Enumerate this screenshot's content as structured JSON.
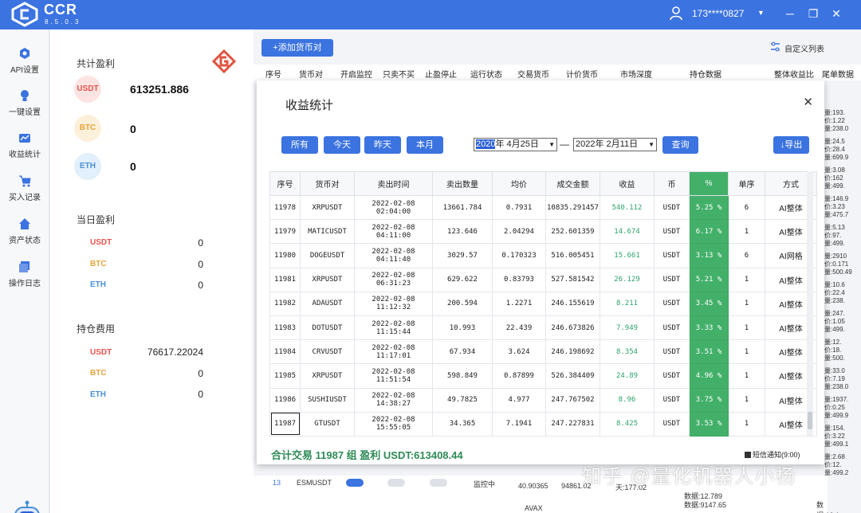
{
  "app": {
    "name": "CCR",
    "version": "8.5.0.3"
  },
  "user": {
    "phone": "173****0827"
  },
  "nav": [
    {
      "label": "API设置",
      "icon": "api-icon"
    },
    {
      "label": "一键设置",
      "icon": "bulb-icon"
    },
    {
      "label": "收益统计",
      "icon": "stats-icon"
    },
    {
      "label": "买入记录",
      "icon": "cart-icon"
    },
    {
      "label": "资产状态",
      "icon": "home-icon"
    },
    {
      "label": "操作日志",
      "icon": "log-icon"
    }
  ],
  "summary": {
    "total_title": "共计盈利",
    "total": [
      {
        "coin": "USDT",
        "value": "613251.886",
        "color": "#e8534c",
        "bg": "#fde4e3"
      },
      {
        "coin": "BTC",
        "value": "0",
        "color": "#e8a33a",
        "bg": "#fdf0da"
      },
      {
        "coin": "ETH",
        "value": "0",
        "color": "#4a8fd6",
        "bg": "#e2effc"
      }
    ],
    "daily_title": "当日盈利",
    "daily": [
      {
        "coin": "USDT",
        "value": "0",
        "color": "#e8534c"
      },
      {
        "coin": "BTC",
        "value": "0",
        "color": "#e8a33a"
      },
      {
        "coin": "ETH",
        "value": "0",
        "color": "#4a8fd6"
      }
    ],
    "fee_title": "持仓费用",
    "fee": [
      {
        "coin": "USDT",
        "value": "76617.22024",
        "color": "#e8534c"
      },
      {
        "coin": "BTC",
        "value": "0",
        "color": "#e8a33a"
      },
      {
        "coin": "ETH",
        "value": "0",
        "color": "#4a8fd6"
      }
    ]
  },
  "main": {
    "add_button": "+添加货币对",
    "custom_columns": "自定义列表",
    "headers": [
      "序号",
      "货币对",
      "开启监控",
      "只卖不买",
      "止盈停止",
      "运行状态",
      "交易货币",
      "计价货币",
      "市场深度",
      "持仓数据",
      "整体收益比",
      "尾单数据"
    ],
    "bg_row_cells": [
      "13",
      "ESMUSDT",
      "监控中",
      "40.90365",
      "94861.02",
      "天:177.02",
      "数据:9147.65"
    ],
    "bg_row2_cells": [
      "AVAX",
      "数据:12.789",
      "数据:12.1"
    ],
    "right_col": [
      "量:193.",
      "价:1.22",
      "量:238.0",
      "量:24.5",
      "价:28.4",
      "量:699.9",
      "量:3.08",
      "价:162",
      "量:499.",
      "量:146.9",
      "价:3.23",
      "量:475.7",
      "量:5.13",
      "价:97.",
      "量:499.",
      "量:2910",
      "价:0.171",
      "量:500.49",
      "量:10.6",
      "价:22.4",
      "量:238.",
      "量:247.",
      "价:1.05",
      "量:499.",
      "量:12.",
      "价:18.",
      "量:500.",
      "量:33.0",
      "价:7.19",
      "量:238.0",
      "量:1937.",
      "价:0.25",
      "量:499.9",
      "量:154.",
      "价:3.22",
      "量:499.1",
      "量:2.68",
      "价:12.",
      "量:499.2"
    ],
    "watermark": "知乎 @量化机器人小杨"
  },
  "modal": {
    "title": "收益统计",
    "filters": [
      "所有",
      "今天",
      "昨天",
      "本月"
    ],
    "date_from": {
      "year": "2020",
      "rest": "年  4月25日"
    },
    "date_to": "2022年  2月11日",
    "query_label": "查询",
    "export_label": "↓导出",
    "columns": [
      "序号",
      "货币对",
      "卖出时间",
      "卖出数量",
      "均价",
      "成交金额",
      "收益",
      "币",
      "%",
      "单序",
      "方式"
    ],
    "rows": [
      [
        "11978",
        "XRPUSDT",
        "2022-02-08 02:04:00",
        "13661.784",
        "0.7931",
        "10835.291457",
        "540.112",
        "USDT",
        "5.25 %",
        "6",
        "AI整体"
      ],
      [
        "11979",
        "MATICUSDT",
        "2022-02-08 04:11:00",
        "123.646",
        "2.04294",
        "252.601359",
        "14.674",
        "USDT",
        "6.17 %",
        "1",
        "AI整体"
      ],
      [
        "11980",
        "DOGEUSDT",
        "2022-02-08 04:11:40",
        "3029.57",
        "0.170323",
        "516.005451",
        "15.661",
        "USDT",
        "3.13 %",
        "6",
        "AI网格"
      ],
      [
        "11981",
        "XRPUSDT",
        "2022-02-08 06:31:23",
        "629.622",
        "0.83793",
        "527.581542",
        "26.129",
        "USDT",
        "5.21 %",
        "1",
        "AI整体"
      ],
      [
        "11982",
        "ADAUSDT",
        "2022-02-08 11:12:32",
        "200.594",
        "1.2271",
        "246.155619",
        "8.211",
        "USDT",
        "3.45 %",
        "1",
        "AI整体"
      ],
      [
        "11983",
        "DOTUSDT",
        "2022-02-08 11:15:44",
        "10.993",
        "22.439",
        "246.673826",
        "7.949",
        "USDT",
        "3.33 %",
        "1",
        "AI整体"
      ],
      [
        "11984",
        "CRVUSDT",
        "2022-02-08 11:17:01",
        "67.934",
        "3.624",
        "246.198692",
        "8.354",
        "USDT",
        "3.51 %",
        "1",
        "AI整体"
      ],
      [
        "11985",
        "XRPUSDT",
        "2022-02-08 11:51:54",
        "598.849",
        "0.87899",
        "526.384409",
        "24.89",
        "USDT",
        "4.96 %",
        "1",
        "AI整体"
      ],
      [
        "11986",
        "SUSHIUSDT",
        "2022-02-08 14:38:27",
        "49.7825",
        "4.977",
        "247.767502",
        "8.96",
        "USDT",
        "3.75 %",
        "1",
        "AI整体"
      ],
      [
        "11987",
        "GTUSDT",
        "2022-02-08 15:55:05",
        "34.365",
        "7.1941",
        "247.227831",
        "8.425",
        "USDT",
        "3.53 %",
        "1",
        "AI整体"
      ]
    ],
    "totals": "合计交易 11987 组   盈利 USDT:613408.44",
    "sms": "短信通知(9:00)"
  }
}
